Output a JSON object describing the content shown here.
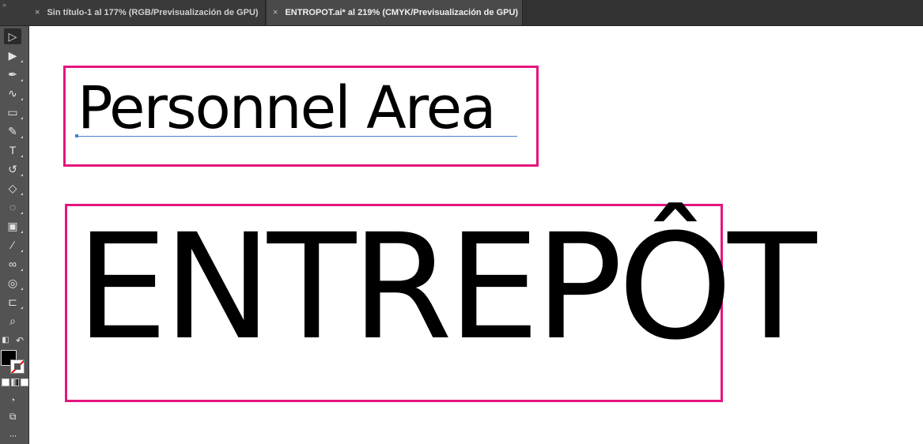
{
  "tabs": [
    {
      "close": "×",
      "label": "Sin título-1 al 177% (RGB/Previsualización de GPU)",
      "active": false
    },
    {
      "close": "×",
      "label": "ENTROPOT.ai* al 219% (CMYK/Previsualización de GPU)",
      "active": true
    }
  ],
  "toolbar": {
    "grip": "»",
    "tools": [
      {
        "name": "selection-tool",
        "glyph": "▷"
      },
      {
        "name": "direct-selection-tool",
        "glyph": "▶"
      },
      {
        "name": "pen-tool",
        "glyph": "✒"
      },
      {
        "name": "curvature-tool",
        "glyph": "∿"
      },
      {
        "name": "rectangle-tool",
        "glyph": "▭"
      },
      {
        "name": "paintbrush-tool",
        "glyph": "✎"
      },
      {
        "name": "type-tool",
        "glyph": "T"
      },
      {
        "name": "rotate-tool",
        "glyph": "↺"
      },
      {
        "name": "eraser-tool",
        "glyph": "◇"
      },
      {
        "name": "warp-tool",
        "glyph": "◌"
      },
      {
        "name": "gradient-tool",
        "glyph": "▣"
      },
      {
        "name": "eyedropper-tool",
        "glyph": "⁄"
      },
      {
        "name": "blend-tool",
        "glyph": "∞"
      },
      {
        "name": "shape-builder-tool",
        "glyph": "◎"
      },
      {
        "name": "artboard-tool",
        "glyph": "⊏"
      },
      {
        "name": "zoom-tool",
        "glyph": "⌕"
      }
    ],
    "bottom": {
      "swap": "↶",
      "more": "···"
    }
  },
  "artboard": {
    "heading": "Personnel Area",
    "title": "ENTREPÔT",
    "frame_color": "#e4157e",
    "baseline_color": "#4a7ed8"
  }
}
